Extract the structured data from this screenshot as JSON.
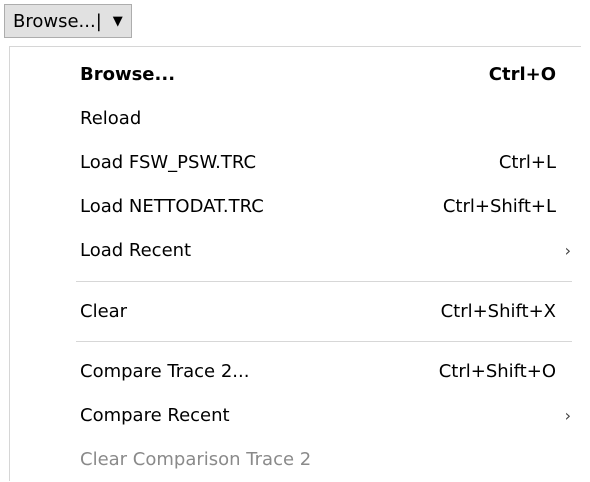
{
  "toolbar": {
    "browse_button": {
      "label": "Browse...|",
      "dropdown_icon": "caret-down-icon",
      "dropdown_glyph": "▼"
    }
  },
  "menu": {
    "items": [
      {
        "label": "Browse...",
        "shortcut": "Ctrl+O",
        "bold": true
      },
      {
        "label": "Reload",
        "shortcut": ""
      },
      {
        "label": "Load FSW_PSW.TRC",
        "shortcut": "Ctrl+L"
      },
      {
        "label": "Load NETTODAT.TRC",
        "shortcut": "Ctrl+Shift+L"
      },
      {
        "label": "Load Recent",
        "submenu_icon": "chevron-right-icon",
        "submenu_glyph": "›"
      },
      {
        "label": "Clear",
        "shortcut": "Ctrl+Shift+X"
      },
      {
        "label": "Compare Trace 2...",
        "shortcut": "Ctrl+Shift+O"
      },
      {
        "label": "Compare Recent",
        "submenu_icon": "chevron-right-icon",
        "submenu_glyph": "›"
      },
      {
        "label": "Clear Comparison Trace 2",
        "disabled": true
      }
    ]
  },
  "colors": {
    "button_background": "#e1e1e1",
    "button_border": "#adadad",
    "menu_background": "#ffffff",
    "separator": "#d7d7d7",
    "disabled_text": "#8a8a8a"
  }
}
